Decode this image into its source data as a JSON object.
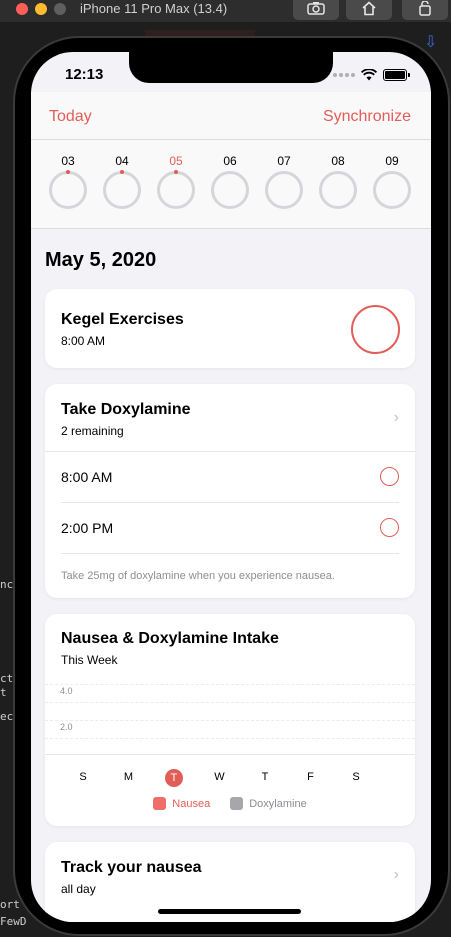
{
  "simulator": {
    "title": "iPhone 11 Pro Max (13.4)",
    "buttons": [
      "screenshot-icon",
      "home-icon",
      "rotate-icon"
    ]
  },
  "background": {
    "lines": [
      "cti",
      "t",
      "ec",
      "nc",
      "ort",
      "FewD"
    ]
  },
  "status": {
    "time": "12:13"
  },
  "nav": {
    "left": "Today",
    "right": "Synchronize"
  },
  "week": {
    "days": [
      {
        "label": "03",
        "started": true
      },
      {
        "label": "04",
        "started": true
      },
      {
        "label": "05",
        "started": true,
        "selected": true
      },
      {
        "label": "06",
        "started": false
      },
      {
        "label": "07",
        "started": false
      },
      {
        "label": "08",
        "started": false
      },
      {
        "label": "09",
        "started": false
      }
    ]
  },
  "date_heading": "May 5, 2020",
  "tasks": {
    "kegel": {
      "title": "Kegel Exercises",
      "time": "8:00 AM"
    },
    "doxylamine": {
      "title": "Take Doxylamine",
      "subtitle": "2 remaining",
      "times": [
        "8:00 AM",
        "2:00 PM"
      ],
      "note": "Take 25mg of doxylamine when you experience nausea."
    },
    "chart": {
      "title": "Nausea & Doxylamine Intake",
      "subtitle": "This Week"
    },
    "track": {
      "title": "Track your nausea",
      "subtitle": "all day"
    }
  },
  "chart_data": {
    "type": "bar",
    "categories": [
      "S",
      "M",
      "T",
      "W",
      "T",
      "F",
      "S"
    ],
    "selected_index": 2,
    "y_ticks": [
      "4.0",
      "2.0"
    ],
    "series": [
      {
        "name": "Nausea",
        "values": [
          0,
          0,
          0,
          0,
          0,
          0,
          0
        ],
        "color": "#ef6e6a"
      },
      {
        "name": "Doxylamine",
        "values": [
          0,
          0,
          0,
          0,
          0,
          0,
          0
        ],
        "color": "#a7a7ab"
      }
    ]
  },
  "colors": {
    "accent": "#e35d58",
    "secondary_text": "#8e8e93"
  }
}
